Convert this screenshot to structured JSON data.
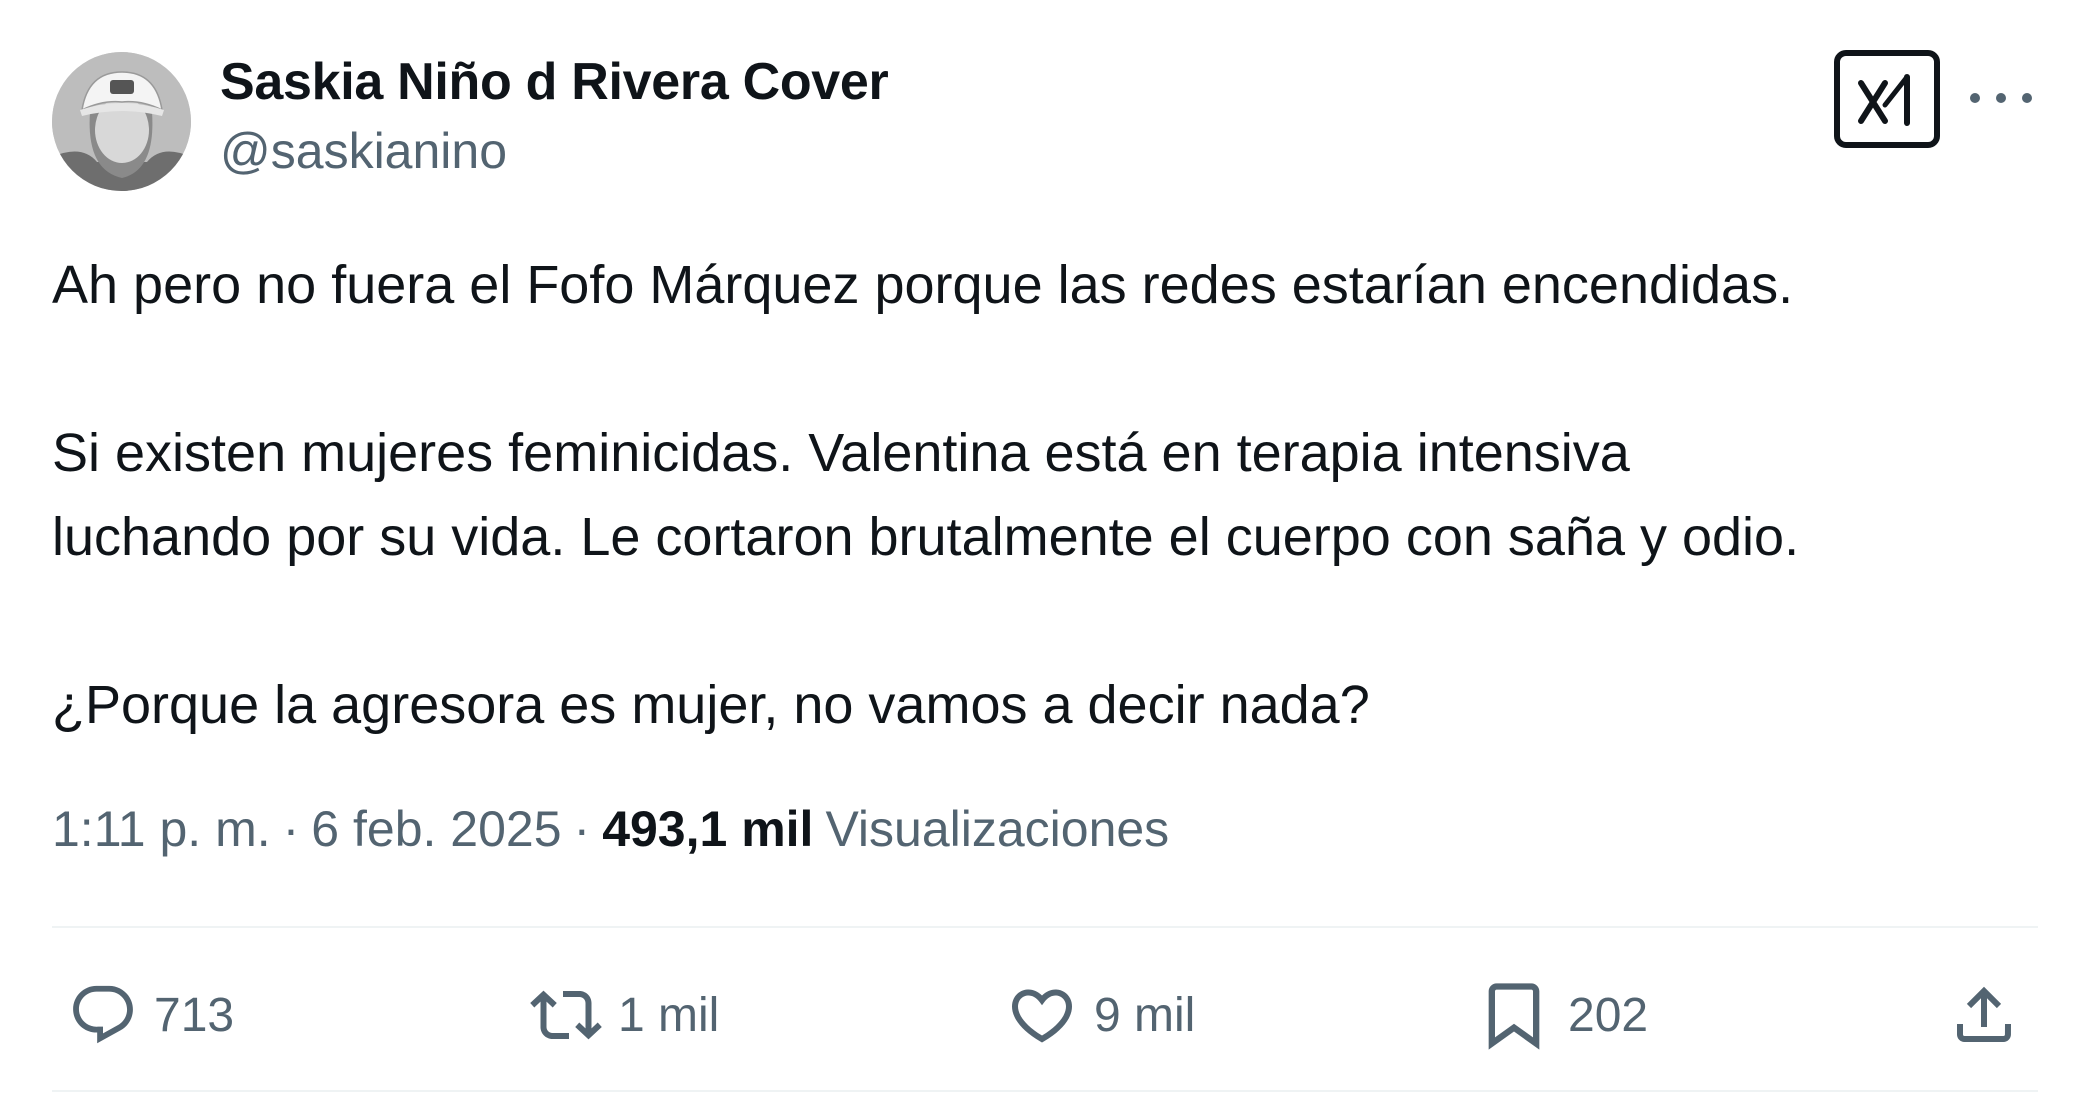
{
  "author": {
    "display_name": "Saskia Niño d Rivera Cover",
    "handle": "@saskianino",
    "avatar_icon": "profile-photo"
  },
  "tweet": {
    "paragraphs": [
      [
        "Ah pero no fuera el Fofo Márquez porque las redes estarían encendidas."
      ],
      [
        "Si existen mujeres feminicidas. Valentina está en terapia intensiva",
        "luchando por su vida. Le cortaron brutalmente el cuerpo con saña y odio."
      ],
      [
        "¿Porque la agresora es mujer, no vamos a decir nada?"
      ]
    ],
    "time": "1:11 p. m.",
    "date": "6 feb. 2025",
    "views_count": "493,1 mil",
    "views_label": "Visualizaciones"
  },
  "actions": {
    "replies": "713",
    "reposts": "1 mil",
    "likes": "9 mil",
    "bookmarks": "202"
  },
  "icons": {
    "grok": "grok-icon",
    "more": "more-icon",
    "reply": "reply-icon",
    "repost": "repost-icon",
    "like": "like-icon",
    "bookmark": "bookmark-icon",
    "share": "share-icon"
  },
  "colors": {
    "text_primary": "#0f1419",
    "text_secondary": "#536471",
    "divider": "#eff3f4"
  }
}
